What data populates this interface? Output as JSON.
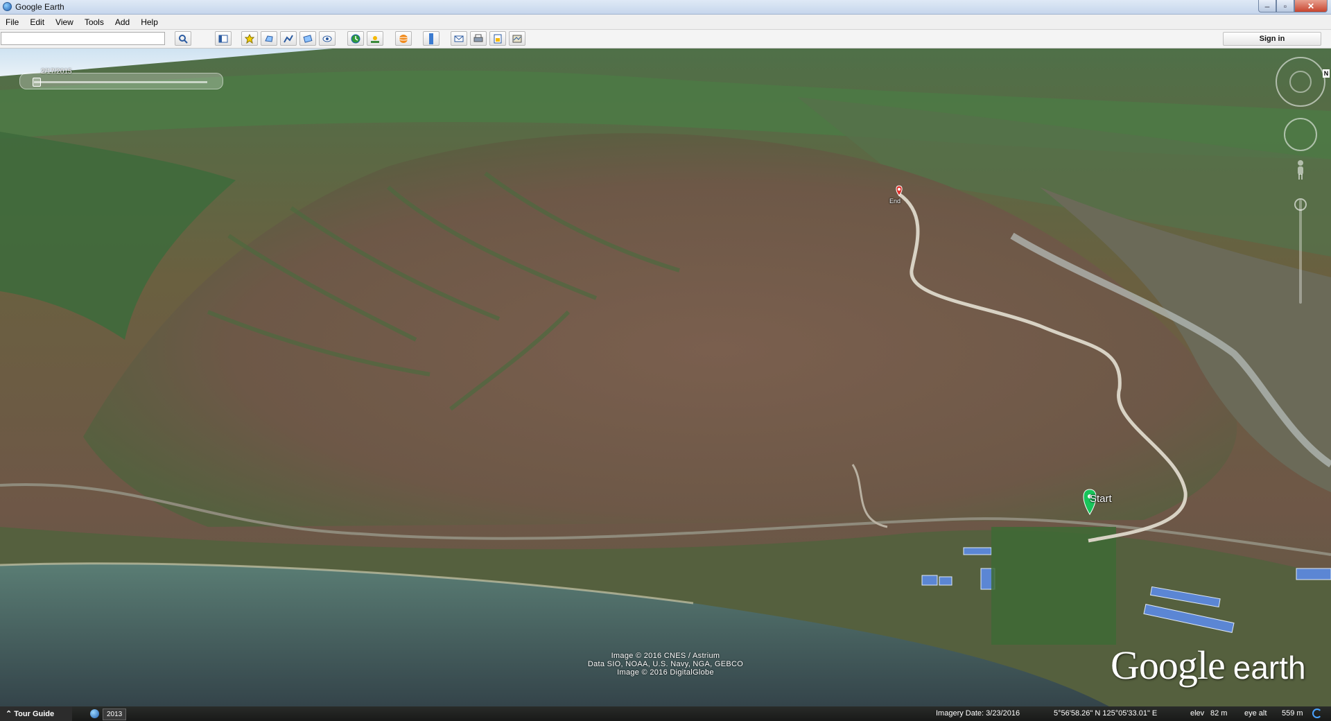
{
  "window": {
    "title": "Google Earth",
    "min_glyph": "–",
    "max_glyph": "▫",
    "close_glyph": "✕"
  },
  "menu": [
    "File",
    "Edit",
    "View",
    "Tools",
    "Add",
    "Help"
  ],
  "search": {
    "value": "",
    "placeholder": ""
  },
  "toolbar": {
    "sign_in_label": "Sign in",
    "icons": [
      "search-icon",
      "sidebar-toggle-icon",
      "add-placemark-icon",
      "add-polygon-icon",
      "add-path-icon",
      "add-image-overlay-icon",
      "record-tour-icon",
      "historical-imagery-icon",
      "sunlight-icon",
      "switch-to-sky-icon",
      "ruler-icon",
      "email-icon",
      "print-icon",
      "save-image-icon",
      "view-in-maps-icon"
    ]
  },
  "time_slider": {
    "date": "2/17/2015"
  },
  "nav": {
    "north_label": "N"
  },
  "placemarks": {
    "end": "End",
    "start": "Start"
  },
  "attribution": [
    "Image © 2016 CNES / Astrium",
    "Data SIO, NOAA, U.S. Navy, NGA, GEBCO",
    "Image © 2016 DigitalGlobe"
  ],
  "logo": {
    "google": "Google",
    "earth": "earth"
  },
  "status": {
    "tour_guide": "Tour Guide",
    "year": "2013",
    "imagery_date": "Imagery Date: 3/23/2016",
    "coords": "5°56'58.26\" N  125°05'33.01\" E",
    "elev_label": "elev",
    "elev_value": "82 m",
    "eye_alt_label": "eye alt",
    "eye_alt_value": "559 m"
  }
}
